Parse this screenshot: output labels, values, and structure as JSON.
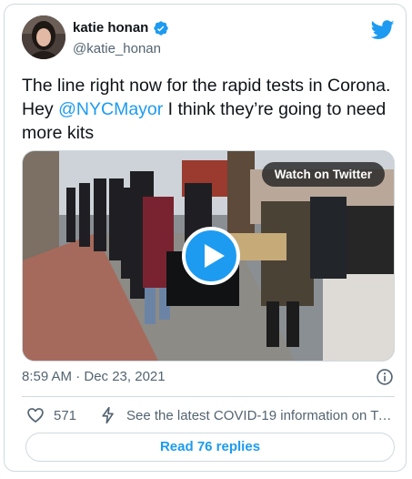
{
  "author": {
    "display_name": "katie honan",
    "handle": "@katie_honan",
    "verified": true
  },
  "tweet": {
    "text_before": "The line right now for the rapid tests in Corona. Hey ",
    "mention": "@NYCMayor",
    "text_after": " I think they’re going to need more kits"
  },
  "media": {
    "type": "video",
    "watch_label": "Watch on Twitter"
  },
  "meta": {
    "timestamp": "8:59 AM · Dec 23, 2021"
  },
  "actions": {
    "like_count": "571",
    "covid_notice": "See the latest COVID-19 information on Twitter",
    "replies_label": "Read 76 replies"
  },
  "colors": {
    "accent": "#1d9bf0",
    "text": "#0f1419",
    "secondary": "#536471",
    "border": "#cfd9de"
  },
  "icons": [
    "verified-badge-icon",
    "twitter-bird-icon",
    "play-icon",
    "info-icon",
    "heart-icon",
    "lightning-icon"
  ]
}
